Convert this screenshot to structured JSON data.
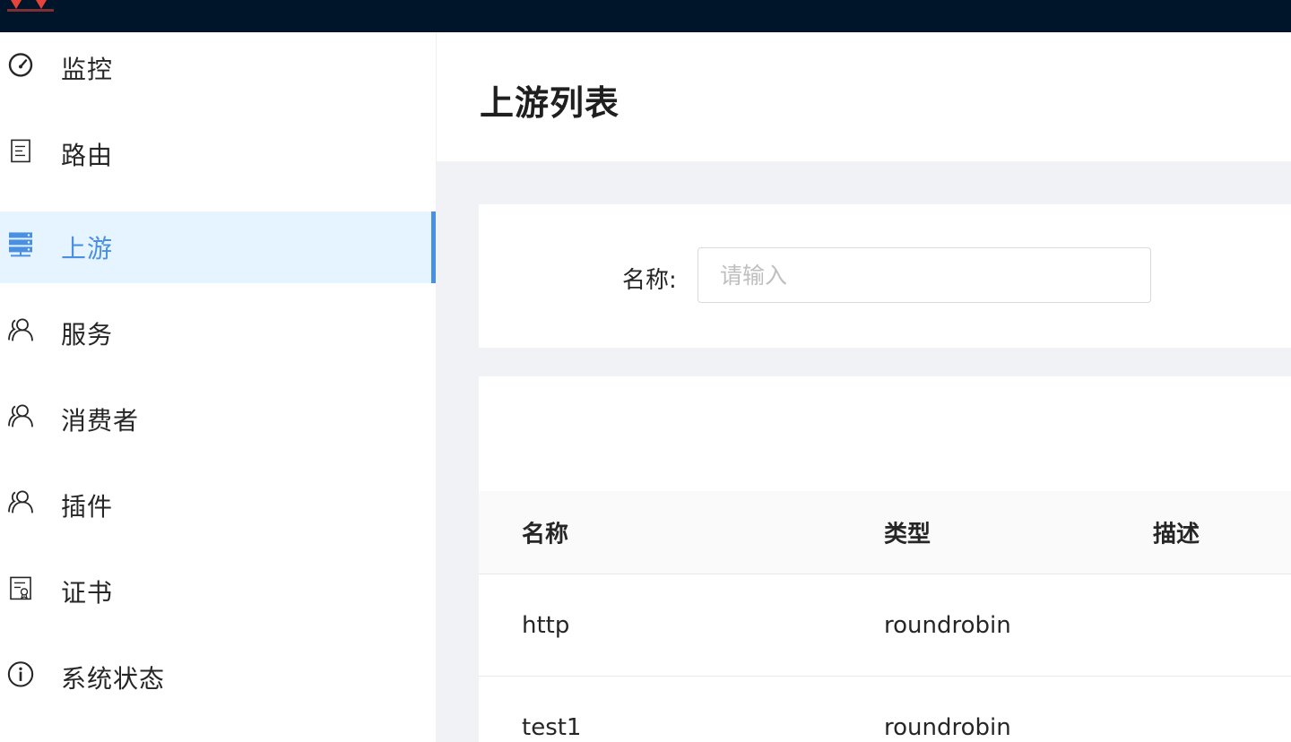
{
  "sidebar": {
    "items": [
      {
        "label": "监控",
        "icon": "dashboard-icon",
        "active": false
      },
      {
        "label": "路由",
        "icon": "route-document-icon",
        "active": false
      },
      {
        "label": "上游",
        "icon": "server-stack-icon",
        "active": true
      },
      {
        "label": "服务",
        "icon": "users-icon",
        "active": false
      },
      {
        "label": "消费者",
        "icon": "users-icon",
        "active": false
      },
      {
        "label": "插件",
        "icon": "users-icon",
        "active": false
      },
      {
        "label": "证书",
        "icon": "certificate-icon",
        "active": false
      },
      {
        "label": "系统状态",
        "icon": "info-icon",
        "active": false
      }
    ]
  },
  "page": {
    "title": "上游列表"
  },
  "search": {
    "name_label": "名称:",
    "name_placeholder": "请输入"
  },
  "table": {
    "columns": [
      "名称",
      "类型",
      "描述"
    ],
    "rows": [
      {
        "name": "http",
        "type": "roundrobin",
        "description": ""
      },
      {
        "name": "test1",
        "type": "roundrobin",
        "description": ""
      }
    ]
  },
  "colors": {
    "topbar": "#001529",
    "accent": "#4a90e2",
    "active_bg": "#e6f4ff",
    "logo_red": "#e8433a"
  }
}
